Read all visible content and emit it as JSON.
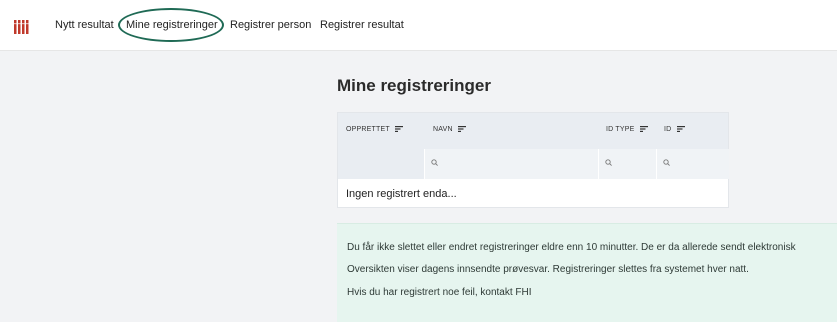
{
  "nav": {
    "items": [
      {
        "label": "Nytt resultat"
      },
      {
        "label": "Mine registreringer"
      },
      {
        "label": "Registrer person"
      },
      {
        "label": "Registrer resultat"
      }
    ],
    "active_index": 1,
    "logo_icon": "test-tubes-icon"
  },
  "main": {
    "title": "Mine registreringer",
    "table": {
      "columns": [
        {
          "label": "OPPRETTET",
          "sortable": true,
          "filterable": false
        },
        {
          "label": "NAVN",
          "sortable": true,
          "filterable": true
        },
        {
          "label": "ID TYPE",
          "sortable": true,
          "filterable": true
        },
        {
          "label": "ID",
          "sortable": true,
          "filterable": true
        }
      ],
      "empty_text": "Ingen registrert enda..."
    },
    "info": {
      "lines": [
        "Du får ikke slettet eller endret registreringer eldre enn 10 minutter. De er da allerede sendt elektronisk",
        "Oversikten viser dagens innsendte prøvesvar. Registreringer slettes fra systemet hver natt.",
        "Hvis du har registrert noe feil, kontakt FHI"
      ]
    }
  },
  "colors": {
    "accent_ring": "#1f6a55",
    "logo_red": "#c0392b",
    "info_bg": "#e6f5ef"
  }
}
